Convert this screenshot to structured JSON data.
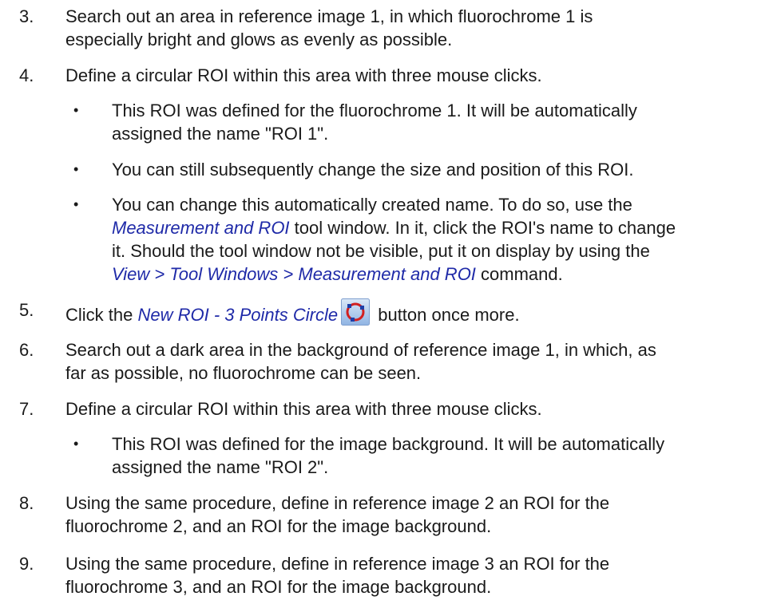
{
  "steps": [
    {
      "num": "3.",
      "line1": "Search out an area in reference image 1, in which fluorochrome 1 is",
      "line2": "especially bright and glows as evenly as possible."
    },
    {
      "num": "4.",
      "line1": "Define a circular ROI within this area with three mouse clicks."
    },
    {
      "num": "5.",
      "pre": "Click the ",
      "link": "New ROI - 3 Points Circle",
      "post": " button once more.",
      "icon": "roi-circle-icon"
    },
    {
      "num": "6.",
      "line1": "Search out a dark area in the background of reference image 1, in which, as",
      "line2": "far as possible, no fluorochrome can be seen."
    },
    {
      "num": "7.",
      "line1": "Define a circular ROI within this area with three mouse clicks."
    },
    {
      "num": "8.",
      "line1": "Using the same procedure, define in reference image 2 an ROI for the",
      "line2": "fluorochrome 2, and an ROI for the image background."
    },
    {
      "num": "9.",
      "line1": "Using the same procedure, define in reference image 3 an ROI for the",
      "line2": "fluorochrome 3, and an ROI for the image background."
    }
  ],
  "bullets": {
    "b1": {
      "line1": "This ROI was defined for the fluorochrome 1. It will be automatically",
      "line2": "assigned the name \"ROI 1\"."
    },
    "b2": {
      "line1": "You can still subsequently change the size and position of this ROI."
    },
    "b3": {
      "line1": "You can change this automatically created name. To do so, use the",
      "l2_link": "Measurement and ROI",
      "l2_rest": " tool window. In it, click the ROI's name to change",
      "line3": "it. Should the tool window not be visible, put it on display by using the",
      "l4_link": "View > Tool Windows > Measurement and ROI",
      "l4_rest": " command."
    },
    "b4": {
      "line1": "This ROI was defined for the image background. It will be automatically",
      "line2": "assigned the name \"ROI 2\"."
    }
  },
  "bullet_char": "•"
}
